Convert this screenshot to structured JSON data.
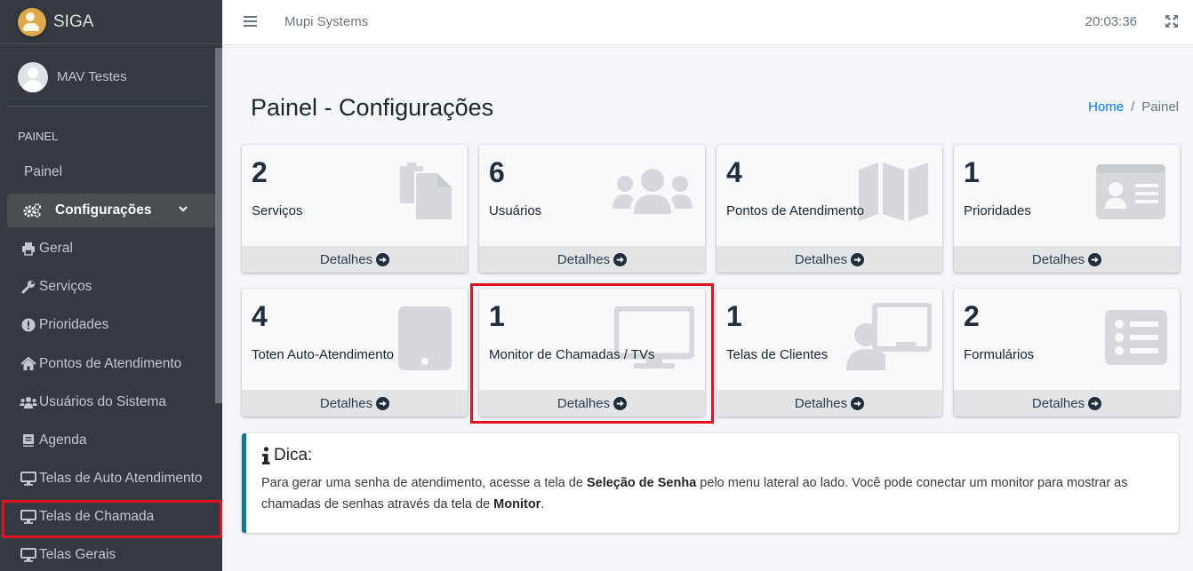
{
  "brand": {
    "name": "SIGA"
  },
  "user": {
    "name": "MAV Testes"
  },
  "sidebar": {
    "header": "PAINEL",
    "items": [
      {
        "label": "Painel",
        "icon": "none"
      },
      {
        "label": "Configurações",
        "icon": "cogs-icon",
        "active": true
      },
      {
        "label": "Geral",
        "icon": "print-icon"
      },
      {
        "label": "Serviços",
        "icon": "wrench-icon"
      },
      {
        "label": "Prioridades",
        "icon": "exclamation-circle-icon"
      },
      {
        "label": "Pontos de Atendimento",
        "icon": "home-icon"
      },
      {
        "label": "Usuários do Sistema",
        "icon": "users-icon"
      },
      {
        "label": "Agenda",
        "icon": "book-icon"
      },
      {
        "label": "Telas de Auto Atendimento",
        "icon": "desktop-icon"
      },
      {
        "label": "Telas de Chamada",
        "icon": "desktop-icon",
        "highlighted": true
      },
      {
        "label": "Telas Gerais",
        "icon": "desktop-icon"
      }
    ]
  },
  "topbar": {
    "company": "Mupi Systems",
    "clock": "20:03:36"
  },
  "page": {
    "title": "Painel - Configurações"
  },
  "breadcrumb": {
    "home": "Home",
    "separator": "/",
    "current": "Painel"
  },
  "boxes": [
    {
      "count": "2",
      "label": "Serviços",
      "icon": "copy-icon",
      "footer": "Detalhes"
    },
    {
      "count": "6",
      "label": "Usuários",
      "icon": "users-icon",
      "footer": "Detalhes"
    },
    {
      "count": "4",
      "label": "Pontos de Atendimento",
      "icon": "map-icon",
      "footer": "Detalhes"
    },
    {
      "count": "1",
      "label": "Prioridades",
      "icon": "id-card-icon",
      "footer": "Detalhes"
    },
    {
      "count": "4",
      "label": "Toten Auto-Atendimento",
      "icon": "tablet-icon",
      "footer": "Detalhes"
    },
    {
      "count": "1",
      "label": "Monitor de Chamadas / TVs",
      "icon": "desktop-icon",
      "footer": "Detalhes",
      "highlighted": true
    },
    {
      "count": "1",
      "label": "Telas de Clientes",
      "icon": "chalkboard-teacher-icon",
      "footer": "Detalhes"
    },
    {
      "count": "2",
      "label": "Formulários",
      "icon": "list-alt-icon",
      "footer": "Detalhes"
    }
  ],
  "tip": {
    "title": "Dica:",
    "text_1": "Para gerar uma senha de atendimento, acesse a tela de ",
    "bold_1": "Seleção de Senha",
    "text_2": " pelo menu lateral ao lado. Você pode conectar um monitor para mostrar as chamadas de senhas através da tela de ",
    "bold_2": "Monitor",
    "text_3": "."
  },
  "colors": {
    "sidebar_bg": "#343a40",
    "highlight": "#e0141e",
    "tip_border": "#117a8b",
    "link": "#007bff"
  }
}
